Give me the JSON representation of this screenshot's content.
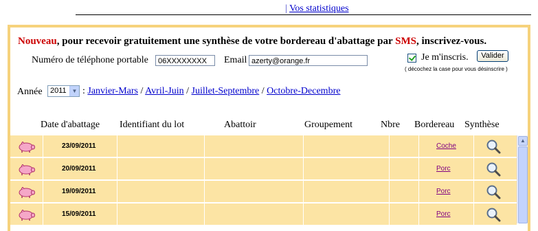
{
  "top": {
    "separator": "|",
    "stats_link": "Vos statistiques"
  },
  "promo": {
    "nouveau": "Nouveau",
    "text1": ", pour recevoir gratuitement une synthèse de votre bordereau d'abattage par ",
    "sms": "SMS",
    "text2": ", inscrivez-vous."
  },
  "form": {
    "phone_label": "Numéro de téléphone portable",
    "phone_value": "06XXXXXXXX",
    "email_label": "Email",
    "email_value": "azerty@orange.fr",
    "checkbox_label": "Je m'inscris.",
    "checkbox_checked": true,
    "submit_label": "Valider",
    "uncheck_hint": "( décochez la case pour vous désinscrire )"
  },
  "filter": {
    "year_label": "Année",
    "year_value": "2011",
    "colon": ":",
    "sep": "/",
    "periods": [
      "Janvier-Mars",
      "Avril-Juin",
      "Juillet-Septembre",
      "Octobre-Decembre"
    ]
  },
  "table": {
    "headers": [
      "Date d'abattage",
      "Identifiant du lot",
      "Abattoir",
      "Groupement",
      "Nbre",
      "Bordereau",
      "Synthèse"
    ],
    "rows": [
      {
        "date": "23/09/2011",
        "bordereau": "Coche"
      },
      {
        "date": "20/09/2011",
        "bordereau": "Porc"
      },
      {
        "date": "19/09/2011",
        "bordereau": "Porc"
      },
      {
        "date": "15/09/2011",
        "bordereau": "Porc"
      }
    ]
  },
  "icons": {
    "row_icon": "pig-icon",
    "synthese_icon": "magnifier-icon",
    "scroll_up": "scroll-up-arrow-icon"
  },
  "colors": {
    "panel_border": "#f6d27c",
    "row_bg": "#fce4a4",
    "link": "#0000cc",
    "visited": "#800080",
    "accent_red": "#cc0000"
  }
}
